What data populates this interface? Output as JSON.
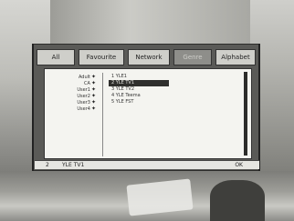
{
  "tabs": [
    {
      "label": "All",
      "active": false
    },
    {
      "label": "Favourite",
      "active": false
    },
    {
      "label": "Network",
      "active": false
    },
    {
      "label": "Genre",
      "active": true
    },
    {
      "label": "Alphabet",
      "active": false
    }
  ],
  "groups": [
    {
      "label": "Adult",
      "arrow": "✦"
    },
    {
      "label": "CA",
      "arrow": "✦"
    },
    {
      "label": "User1",
      "arrow": "✦"
    },
    {
      "label": "User2",
      "arrow": "✦"
    },
    {
      "label": "User3",
      "arrow": "✦"
    },
    {
      "label": "User4",
      "arrow": "✦"
    }
  ],
  "channels": [
    {
      "label": "1 YLE1",
      "selected": false
    },
    {
      "label": "2 YLE TV1",
      "selected": true
    },
    {
      "label": "3 YLE TV2",
      "selected": false
    },
    {
      "label": "4 YLE Teema",
      "selected": false
    },
    {
      "label": "5 YLE FST",
      "selected": false
    }
  ],
  "footer": {
    "number": "2",
    "name": "YLE TV1",
    "ok": "OK"
  },
  "colors": {
    "selected_bg": "#2f2f2d",
    "panel_bg": "#f4f4f0",
    "tab_active": "#8e8e8a"
  }
}
